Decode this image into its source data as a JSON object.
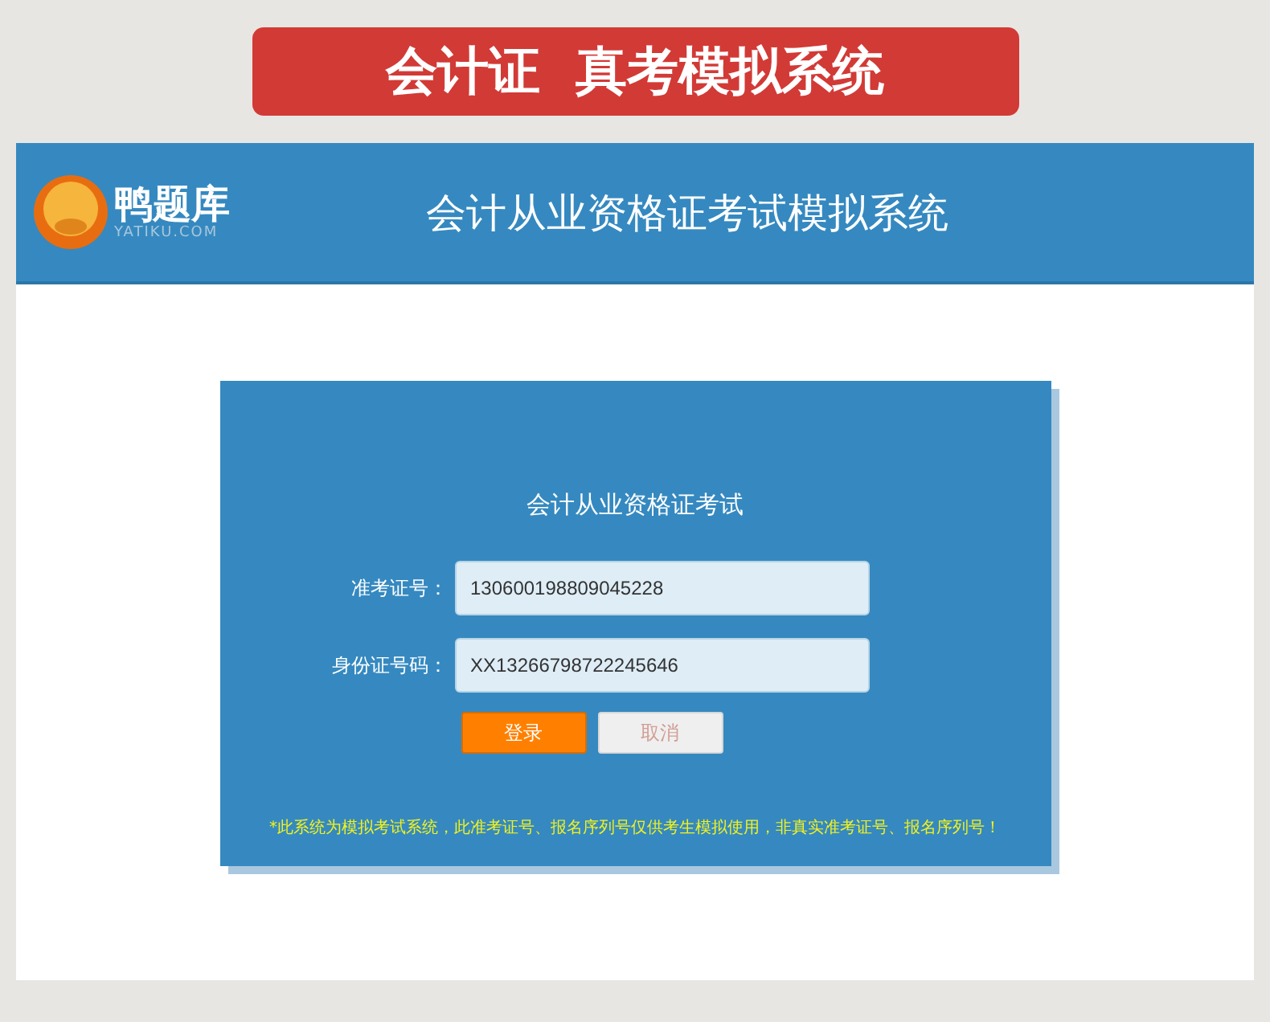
{
  "banner": {
    "title": "会计证  真考模拟系统"
  },
  "header": {
    "logo_name": "鸭题库",
    "logo_domain": "YATIKU.COM",
    "title": "会计从业资格证考试模拟系统"
  },
  "login": {
    "title": "会计从业资格证考试",
    "fields": [
      {
        "label": "准考证号：",
        "value": "130600198809045228"
      },
      {
        "label": "身份证号码：",
        "value": "XX13266798722245646"
      }
    ],
    "buttons": [
      {
        "label": "登录",
        "kind": "primary"
      },
      {
        "label": "取消",
        "kind": "secondary"
      }
    ],
    "notice": "*此系统为模拟考试系统，此准考证号、报名序列号仅供考生模拟使用，非真实准考证号、报名序列号！"
  }
}
